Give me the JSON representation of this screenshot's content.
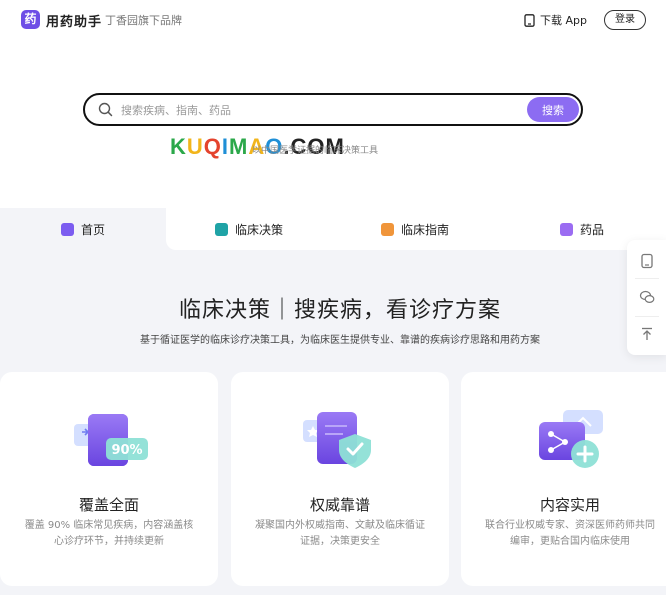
{
  "header": {
    "logo_glyph": "药",
    "brand_name": "用药助手",
    "brand_sub": "丁香园旗下品牌",
    "download_label": "下载 App",
    "login_label": "登录"
  },
  "search": {
    "placeholder": "搜索疾病、指南、药品",
    "button_label": "搜索"
  },
  "watermark": {
    "letters": [
      "K",
      "U",
      "Q",
      "I",
      "M",
      "A",
      "O",
      ".",
      "C",
      "O",
      "M"
    ]
  },
  "tagline": "以中国医学证据的临床决策工具",
  "tabs": [
    {
      "label": "首页",
      "icon": "home-icon",
      "color": "#7b5cf0"
    },
    {
      "label": "临床决策",
      "icon": "briefcase-icon",
      "color": "#1fa3a6"
    },
    {
      "label": "临床指南",
      "icon": "book-icon",
      "color": "#f0953a"
    },
    {
      "label": "药品",
      "icon": "pill-box-icon",
      "color": "#9b6cf2"
    }
  ],
  "main": {
    "title": "临床决策｜搜疾病，看诊疗方案",
    "subtitle": "基于循证医学的临床诊疗决策工具，为临床医生提供专业、靠谱的疾病诊疗思路和用药方案",
    "cards": [
      {
        "title": "覆盖全面",
        "badge": "90%",
        "desc": "覆盖 90% 临床常见疾病，内容涵盖核心诊疗环节，并持续更新"
      },
      {
        "title": "权威靠谱",
        "desc": "凝聚国内外权威指南、文献及临床循证证据，决策更安全"
      },
      {
        "title": "内容实用",
        "desc": "联合行业权威专家、资深医师药师共同编审，更贴合国内临床使用"
      }
    ]
  },
  "colors": {
    "accent": "#8c6cf2",
    "page_bg": "#f3f4f8"
  }
}
